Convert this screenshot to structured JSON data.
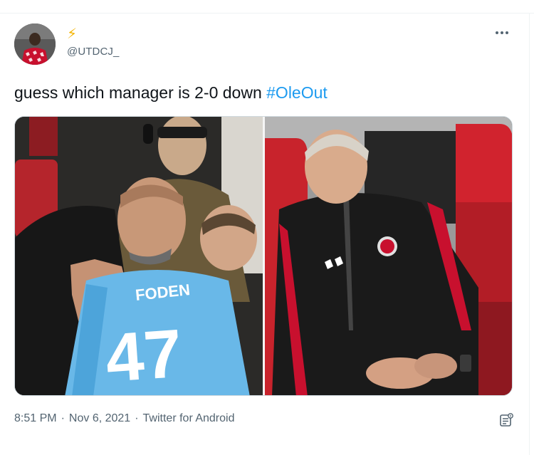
{
  "user": {
    "emoji": "⚡",
    "handle": "@UTDCJ_"
  },
  "tweet": {
    "text": "guess which manager is 2-0 down ",
    "hashtag": "#OleOut"
  },
  "media": {
    "left_jersey_name": "FODEN",
    "left_jersey_number": "47"
  },
  "meta": {
    "time": "8:51 PM",
    "separator": "·",
    "date": "Nov 6, 2021",
    "source": "Twitter for Android"
  },
  "colors": {
    "link": "#1d9bf0",
    "secondary_text": "#536471",
    "primary_text": "#0f1419",
    "bolt": "#f4b400"
  },
  "icons": {
    "more": "more-icon",
    "analytics": "analytics-icon"
  }
}
